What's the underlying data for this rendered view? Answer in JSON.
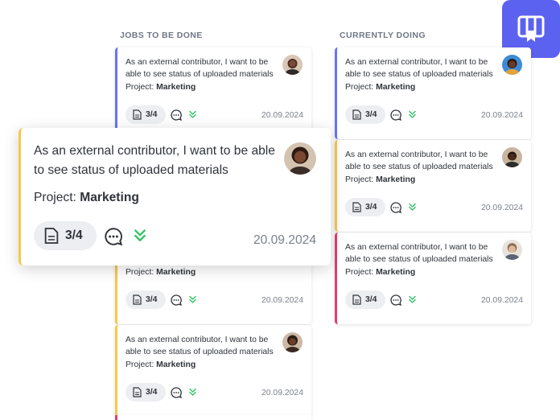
{
  "columns": {
    "todo_title": "JOBS TO BE DONE",
    "doing_title": "CURRENTLY DOING"
  },
  "colors": {
    "accent_blue": "#6a74f4",
    "accent_yellow": "#f5c84b",
    "accent_red": "#e23d71",
    "chevron_green": "#3bc46b"
  },
  "card_text": {
    "description": "As an external contributor, I want to be able to see status of uploaded materials",
    "project_label": "Project:",
    "project_name": "Marketing",
    "count": "3/4",
    "date": "20.09.2024"
  },
  "icons": {
    "doc": "document-icon",
    "comment": "comment-icon",
    "priority": "double-chevron-down-icon",
    "brand": "kanban-logo-icon"
  }
}
